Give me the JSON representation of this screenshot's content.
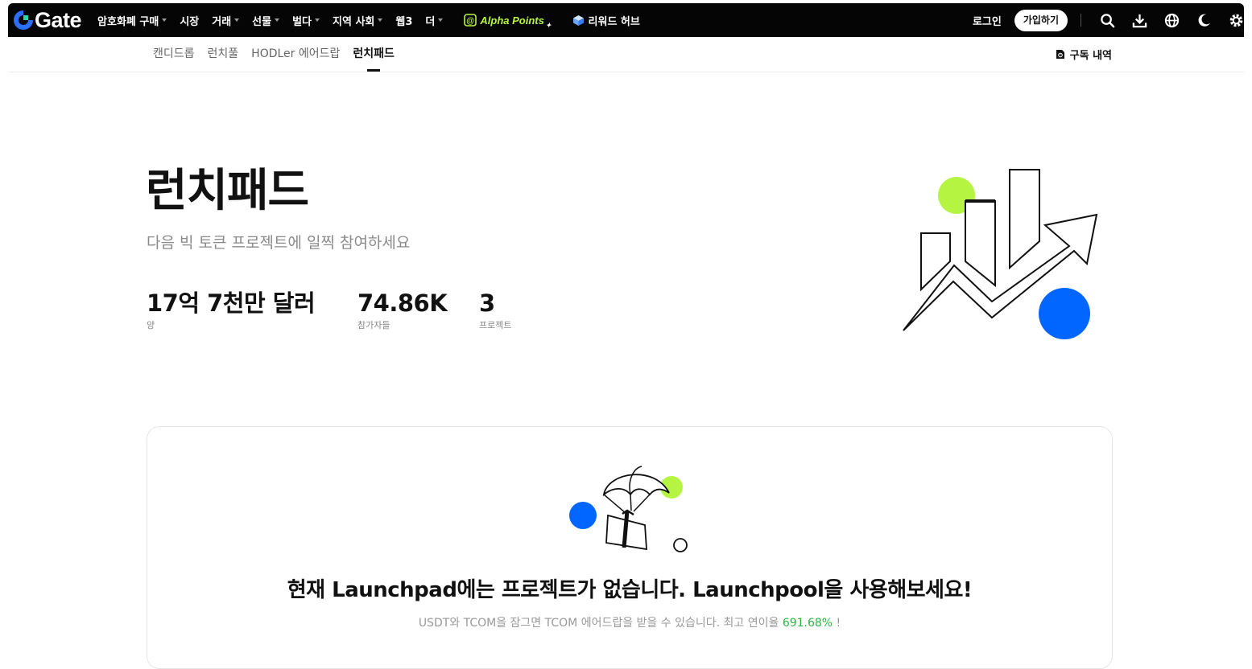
{
  "brand": {
    "name": "Gate",
    "accent_green": "#b5f542",
    "accent_blue": "#0066ff"
  },
  "topnav": {
    "items": [
      {
        "label": "암호화폐 구매",
        "has_caret": true
      },
      {
        "label": "시장",
        "has_caret": false
      },
      {
        "label": "거래",
        "has_caret": true
      },
      {
        "label": "선물",
        "has_caret": true
      },
      {
        "label": "벌다",
        "has_caret": true
      },
      {
        "label": "지역 사회",
        "has_caret": true
      },
      {
        "label": "웹3",
        "has_caret": false
      },
      {
        "label": "더",
        "has_caret": true
      }
    ],
    "alpha_points": "Alpha Points",
    "reward_hub": "리워드 허브",
    "login": "로그인",
    "signup": "가입하기",
    "icons": [
      "search-icon",
      "download-icon",
      "globe-icon",
      "moon-icon",
      "gear-icon"
    ]
  },
  "subnav": {
    "tabs": [
      {
        "label": "캔디드롭",
        "active": false
      },
      {
        "label": "런치풀",
        "active": false
      },
      {
        "label": "HODLer 에어드랍",
        "active": false
      },
      {
        "label": "런치패드",
        "active": true
      }
    ],
    "history": "구독 내역"
  },
  "hero": {
    "title": "런치패드",
    "subtitle": "다음 빅 토큰 프로젝트에 일찍 참여하세요",
    "stats": [
      {
        "value": "17억 7천만 달러",
        "label": "양"
      },
      {
        "value": "74.86K",
        "label": "참가자들"
      },
      {
        "value": "3",
        "label": "프로젝트"
      }
    ]
  },
  "empty_card": {
    "title": "현재 Launchpad에는 프로젝트가 없습니다. Launchpool을 사용해보세요!",
    "subtitle_prefix": "USDT와 TCOM을 잠그면 TCOM 에어드랍을 받을 수 있습니다. 최고 연이율 ",
    "apr": "691.68%",
    "subtitle_suffix": " !"
  }
}
